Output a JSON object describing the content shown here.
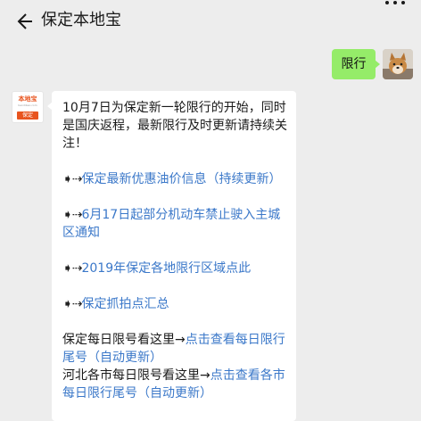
{
  "header": {
    "title": "保定本地宝"
  },
  "user_message": {
    "text": "限行"
  },
  "oa": {
    "avatar_logo": "本地宝",
    "avatar_sub": "bendibao.com",
    "avatar_tag": "保定"
  },
  "message": {
    "intro": "10月7日为保定新一轮限行的开始，同时是国庆返程，最新限行及时更新请持续关注！",
    "bullet": "➧⇢",
    "links": [
      "保定最新优惠油价信息（持续更新）",
      "6月17日起部分机动车禁止驶入主城区通知",
      "2019年保定各地限行区域点此",
      "保定抓拍点汇总"
    ],
    "daily_prefix": "保定每日限号看这里→",
    "daily_link": "点击查看每日限行尾号（自动更新）",
    "hebei_prefix": "河北各市每日限号看这里→",
    "hebei_link": "点击查看各市每日限行尾号（自动更新）"
  },
  "icons": [
    "back-arrow-icon",
    "more-icon"
  ],
  "colors": {
    "background": "#ededed",
    "user_bubble": "#95ec69",
    "link": "#3b78c9",
    "brand": "#e8541e"
  }
}
